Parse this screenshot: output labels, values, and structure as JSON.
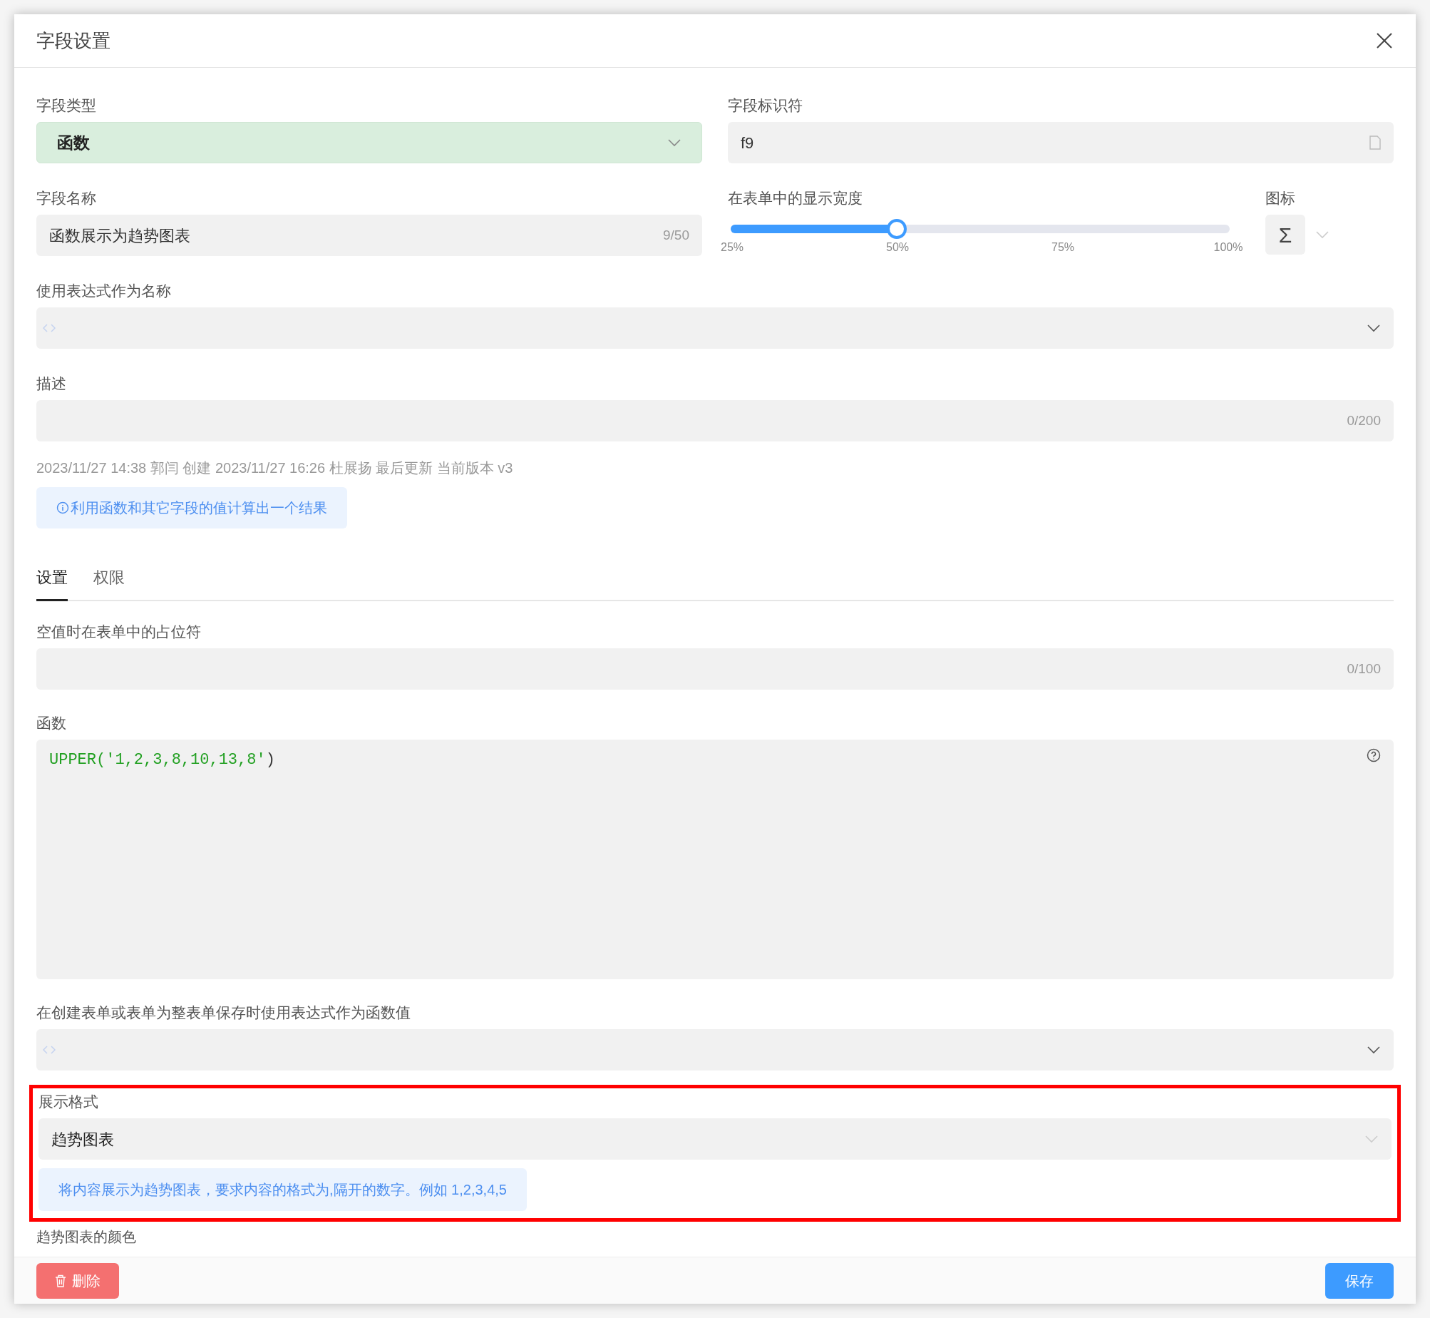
{
  "dialog": {
    "title": "字段设置"
  },
  "field_type": {
    "label": "字段类型",
    "value": "函数"
  },
  "field_id": {
    "label": "字段标识符",
    "value": "f9"
  },
  "field_name": {
    "label": "字段名称",
    "value": "函数展示为趋势图表",
    "counter": "9/50"
  },
  "display_width": {
    "label": "在表单中的显示宽度",
    "level": 0.333,
    "ticks": [
      "25%",
      "50%",
      "75%",
      "100%"
    ]
  },
  "icon": {
    "label": "图标",
    "glyph": "Σ"
  },
  "name_expression": {
    "label": "使用表达式作为名称"
  },
  "description": {
    "label": "描述",
    "counter": "0/200"
  },
  "meta": "2023/11/27 14:38 郭闫 创建 2023/11/27 16:26 杜展扬 最后更新 当前版本 v3",
  "info": "利用函数和其它字段的值计算出一个结果",
  "tabs": [
    {
      "label": "设置",
      "selected": true
    },
    {
      "label": "权限",
      "selected": false
    }
  ],
  "placeholder_field": {
    "label": "空值时在表单中的占位符",
    "counter": "0/100"
  },
  "function": {
    "label": "函数",
    "tokens": [
      {
        "kind": "name",
        "text": "UPPER("
      },
      {
        "kind": "string",
        "text": "'1,2,3,8,10,13,8'"
      },
      {
        "kind": "punct",
        "text": ")"
      }
    ]
  },
  "value_expression": {
    "label": "在创建表单或表单为整表单保存时使用表达式作为函数值"
  },
  "display_format": {
    "label": "展示格式",
    "value": "趋势图表",
    "hint": "将内容展示为趋势图表，要求内容的格式为,隔开的数字。例如 1,2,3,4,5",
    "highlighted": true
  },
  "next_label": "趋势图表的颜色",
  "footer": {
    "delete": "删除",
    "save": "保存"
  }
}
